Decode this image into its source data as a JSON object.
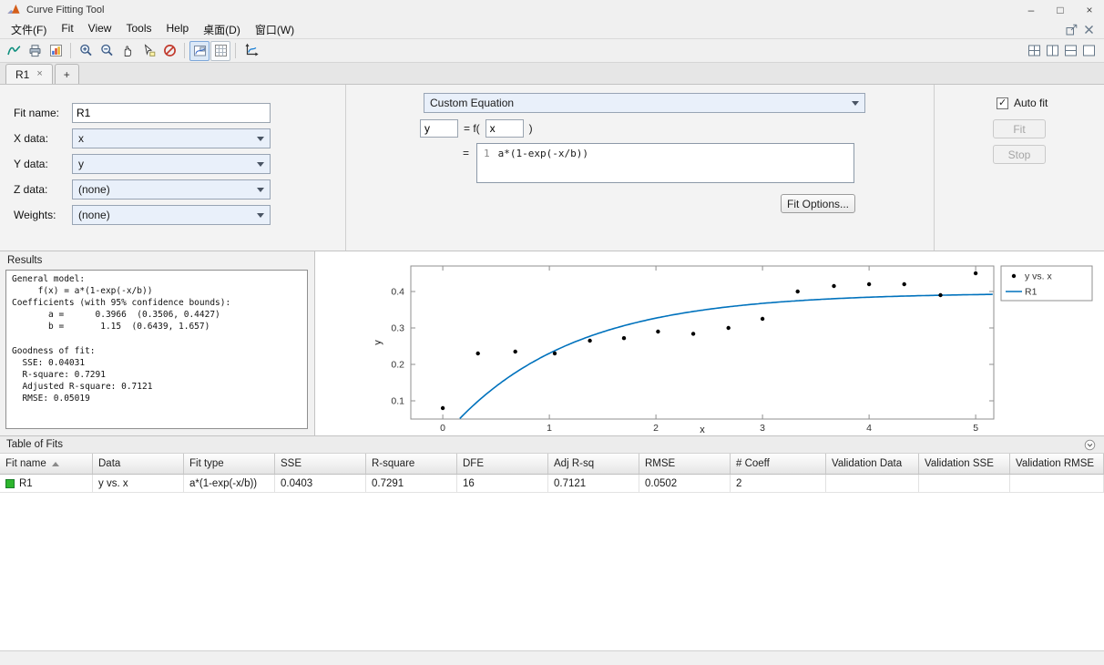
{
  "window": {
    "title": "Curve Fitting Tool",
    "controls": {
      "minimize": "–",
      "maximize": "□",
      "close": "×"
    }
  },
  "menu_bar": {
    "items": [
      {
        "id": "file",
        "label": "文件(F)"
      },
      {
        "id": "fit",
        "label": "Fit"
      },
      {
        "id": "view",
        "label": "View"
      },
      {
        "id": "tools",
        "label": "Tools"
      },
      {
        "id": "help",
        "label": "Help"
      },
      {
        "id": "desktop",
        "label": "桌面(D)"
      },
      {
        "id": "window",
        "label": "窗口(W)"
      }
    ],
    "right_icons": [
      "undock-icon",
      "close-panel-icon"
    ]
  },
  "toolbar": {
    "icons": [
      {
        "name": "new-fit-icon"
      },
      {
        "name": "print-icon"
      },
      {
        "name": "figure-palette-icon"
      },
      {
        "name": "separator"
      },
      {
        "name": "zoom-in-icon"
      },
      {
        "name": "zoom-out-icon"
      },
      {
        "name": "pan-icon"
      },
      {
        "name": "datacursor-icon"
      },
      {
        "name": "exclude-outliers-icon"
      },
      {
        "name": "separator"
      },
      {
        "name": "legend-toggle-icon",
        "toggle": true,
        "pressed": true
      },
      {
        "name": "grid-toggle-icon",
        "toggle": true,
        "pressed": false
      },
      {
        "name": "separator"
      },
      {
        "name": "axes-limits-icon"
      }
    ],
    "layout_icons": [
      "tile-grid-icon",
      "tile-left-icon",
      "tile-bottom-icon",
      "tile-single-icon"
    ]
  },
  "tab_bar": {
    "tabs": [
      {
        "label": "R1",
        "active": true
      }
    ],
    "add_label": "+"
  },
  "fit_panel": {
    "fields": [
      {
        "name": "fit-name",
        "label": "Fit name:",
        "value": "R1",
        "type": "input"
      },
      {
        "name": "x-data",
        "label": "X data:",
        "value": "x",
        "type": "select"
      },
      {
        "name": "y-data",
        "label": "Y data:",
        "value": "y",
        "type": "select"
      },
      {
        "name": "z-data",
        "label": "Z data:",
        "value": "(none)",
        "type": "select"
      },
      {
        "name": "weights",
        "label": "Weights:",
        "value": "(none)",
        "type": "select"
      }
    ],
    "equation": {
      "fit_category": "Custom Equation",
      "dependent": "y",
      "f_open": "= f(",
      "independent": "x",
      "f_close": ")",
      "equals": "=",
      "line_number": "1",
      "formula": "a*(1-exp(-x/b))",
      "fit_options_label": "Fit Options..."
    },
    "controls": {
      "auto_fit_label": "Auto fit",
      "auto_fit_checked": true,
      "fit_label": "Fit",
      "stop_label": "Stop"
    }
  },
  "results": {
    "title": "Results",
    "lines": [
      "General model:",
      "     f(x) = a*(1-exp(-x/b))",
      "Coefficients (with 95% confidence bounds):",
      "       a =      0.3966  (0.3506, 0.4427)",
      "       b =       1.15  (0.6439, 1.657)",
      "",
      "Goodness of fit:",
      "  SSE: 0.04031",
      "  R-square: 0.7291",
      "  Adjusted R-square: 0.7121",
      "  RMSE: 0.05019"
    ]
  },
  "chart_data": {
    "type": "scatter",
    "title": "",
    "xlabel": "x",
    "ylabel": "y",
    "xlim": [
      -0.3,
      5.17
    ],
    "ylim": [
      0.05,
      0.47
    ],
    "xticks": [
      0,
      1,
      2,
      3,
      4,
      5
    ],
    "yticks": [
      0.1,
      0.2,
      0.3,
      0.4
    ],
    "grid": false,
    "legend": {
      "position": "outside-top-right",
      "entries": [
        "y vs. x",
        "R1"
      ]
    },
    "series": [
      {
        "name": "y vs. x",
        "type": "scatter",
        "marker": "point",
        "color": "#000000",
        "x": [
          0,
          0.33,
          0.68,
          1.05,
          1.38,
          1.7,
          2.02,
          2.35,
          2.68,
          3.0,
          3.33,
          3.67,
          4.0,
          4.33,
          4.67,
          5.0
        ],
        "y": [
          0.08,
          0.23,
          0.235,
          0.23,
          0.265,
          0.272,
          0.29,
          0.284,
          0.3,
          0.325,
          0.4,
          0.415,
          0.42,
          0.42,
          0.39,
          0.45
        ]
      },
      {
        "name": "R1",
        "type": "line",
        "color": "#0072BD",
        "fit": {
          "a": 0.3966,
          "b": 1.15,
          "formula": "a*(1-exp(-x/b))"
        }
      }
    ]
  },
  "table_of_fits": {
    "title": "Table of Fits",
    "columns": [
      {
        "label": "Fit name",
        "sort": "asc"
      },
      {
        "label": "Data"
      },
      {
        "label": "Fit type"
      },
      {
        "label": "SSE"
      },
      {
        "label": "R-square"
      },
      {
        "label": "DFE"
      },
      {
        "label": "Adj R-sq"
      },
      {
        "label": "RMSE"
      },
      {
        "label": "# Coeff"
      },
      {
        "label": "Validation Data"
      },
      {
        "label": "Validation SSE"
      },
      {
        "label": "Validation RMSE"
      }
    ],
    "rows": [
      {
        "icon": "fit-swatch-green",
        "cells": [
          "R1",
          "y vs. x",
          "a*(1-exp(-x/b))",
          "0.0403",
          "0.7291",
          "16",
          "0.7121",
          "0.0502",
          "2",
          "",
          "",
          ""
        ]
      }
    ]
  },
  "colors": {
    "accent_blue": "#0072BD",
    "fit_swatch_green": "#2db52d",
    "combo_fill": "#e9f0fa"
  }
}
